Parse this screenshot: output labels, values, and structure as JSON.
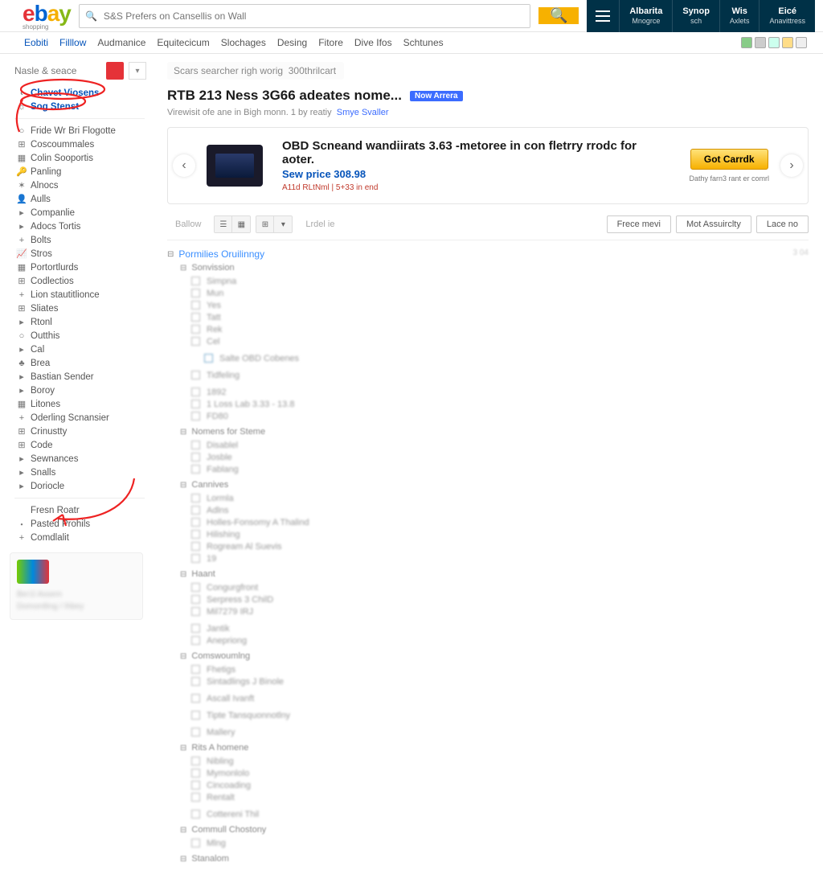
{
  "logo_sub": "shopping",
  "search": {
    "placeholder": "S&S Prefers on Cansellis on Wall"
  },
  "header_items": [
    {
      "l1": "Albarita",
      "l2": "Mnogrce"
    },
    {
      "l1": "Synop",
      "l2": "sch"
    },
    {
      "l1": "Wis",
      "l2": "Axlets"
    },
    {
      "l1": "Eicé",
      "l2": "Anavittress"
    }
  ],
  "nav": [
    "Eobiti",
    "Filllow",
    "Audmanice",
    "Equitecicum",
    "Slochages",
    "Desing",
    "Fitore",
    "Dive Ifos",
    "Schtunes"
  ],
  "side_top": "Nasle & seace",
  "side_links_top": [
    {
      "t": "Chavet Viosens",
      "blue": true,
      "ic": "‹"
    },
    {
      "t": "Sog Stenst",
      "blue": true,
      "ic": "☼"
    }
  ],
  "side_links": [
    {
      "ic": "○",
      "t": "Fride Wr Bri Flogotte"
    },
    {
      "ic": "⊞",
      "t": "Coscoummales"
    },
    {
      "ic": "▦",
      "t": "Colin Sooportis"
    },
    {
      "ic": "🔑",
      "t": "Panling"
    },
    {
      "ic": "✶",
      "t": "Alnocs"
    },
    {
      "ic": "👤",
      "t": "Aulls"
    },
    {
      "ic": "▸",
      "t": "Companlie"
    },
    {
      "ic": "▸",
      "t": "Adocs Tortis"
    },
    {
      "ic": "+",
      "t": "Bolts"
    },
    {
      "ic": "📈",
      "t": "Stros"
    },
    {
      "ic": "▦",
      "t": "Portortlurds"
    },
    {
      "ic": "⊞",
      "t": "Codlectios"
    },
    {
      "ic": "+",
      "t": "Lion stautitlionce"
    },
    {
      "ic": "⊞",
      "t": "Sliates"
    },
    {
      "ic": "▸",
      "t": "Rtonl"
    },
    {
      "ic": "○",
      "t": "Outthis"
    },
    {
      "ic": "▸",
      "t": "Cal"
    },
    {
      "ic": "♣",
      "t": "Brea"
    },
    {
      "ic": "▸",
      "t": "Bastian Sender"
    },
    {
      "ic": "▸",
      "t": "Boroy"
    },
    {
      "ic": "▦",
      "t": "Litones"
    },
    {
      "ic": "+",
      "t": "Oderling Scnansier"
    },
    {
      "ic": "⊞",
      "t": "Crinustty"
    },
    {
      "ic": "⊞",
      "t": "Code"
    },
    {
      "ic": "▸",
      "t": "Sewnances"
    },
    {
      "ic": "▸",
      "t": "Snalls"
    },
    {
      "ic": "▸",
      "t": "Doriocle"
    }
  ],
  "side_links_bottom": [
    {
      "ic": " ",
      "t": "Fresn Roatr"
    },
    {
      "ic": "・",
      "t": "Pasted Prohils"
    },
    {
      "ic": "+",
      "t": "Comdlalit"
    }
  ],
  "crumb_label": "Scars searcher righ worig  300thrilcart",
  "page_title": "RTB 213 Ness 3G66 adeates nome...",
  "pill": "Now Arrera",
  "subtitle_pre": "Virewisit ofe ane in Bigh monn. 1 by reatiy",
  "subtitle_link": "Smye Svaller",
  "promo": {
    "title": "OBD Scneand wandiirats 3.63 -metoree in con fletrry rrodc for aoter.",
    "price": "Sew price  308.98",
    "meta": "A11d RLtNml   |   5+33 in end",
    "cta": "Got Carrdk",
    "cta_sub": "Dathy farn3 rant er comrl"
  },
  "toolbar": {
    "label1": "Ballow",
    "label2": "Lrdel ie"
  },
  "filter_buttons": [
    "Frece mevi",
    "Mot Assuirclty",
    "Lace no"
  ],
  "count_right": "3 04",
  "facet_top": "Pormilies Oruilinngy",
  "facet_groups": [
    {
      "h": "Sonvission",
      "items": [
        "Simpna",
        "Mun",
        "Yes",
        "Tatt",
        "Rek",
        "Cel"
      ]
    },
    {
      "items_indent": [
        "Salte OBD Cobenes"
      ]
    },
    {
      "plain": [
        "Tidfeling"
      ]
    },
    {
      "items": [
        "1892",
        "1  Loss Lab 3.33 - 13.8",
        "FD80"
      ]
    },
    {
      "h": "Nomens for Steme",
      "items": [
        "Disablel",
        "Josble",
        "Fablang"
      ]
    },
    {
      "h": "Cannives",
      "items": [
        "Lormla",
        "Adlns",
        "Holles-Fonsomy A Thalind",
        "Hilishing",
        "Rogream Al Suevis",
        "19"
      ]
    },
    {
      "h": "Haant",
      "items": [
        "Congurgfront",
        "Serpress 3  ChilD",
        "Mil7279 IRJ"
      ]
    },
    {
      "plain": [
        "Jantik",
        "Anepriong"
      ]
    },
    {
      "h": "Comswoumlng",
      "items": [
        "Fhetigs",
        "Sintadlings J  Binole"
      ]
    },
    {
      "plain": [
        "Ascall Ivanft"
      ]
    },
    {
      "items": [
        "Tipte  Tansquonnotlny"
      ]
    },
    {
      "plain": [
        "Mallery"
      ]
    },
    {
      "h": "Rits A homene",
      "items": [
        "Nibling",
        "Mymonlolo",
        "Cincoading",
        "Rentalt"
      ]
    },
    {
      "plain": [
        "Cottereni Thil"
      ]
    },
    {
      "h": "Commull Chostony",
      "items": [
        "Mlng"
      ]
    },
    {
      "h": "Stanalom"
    }
  ]
}
